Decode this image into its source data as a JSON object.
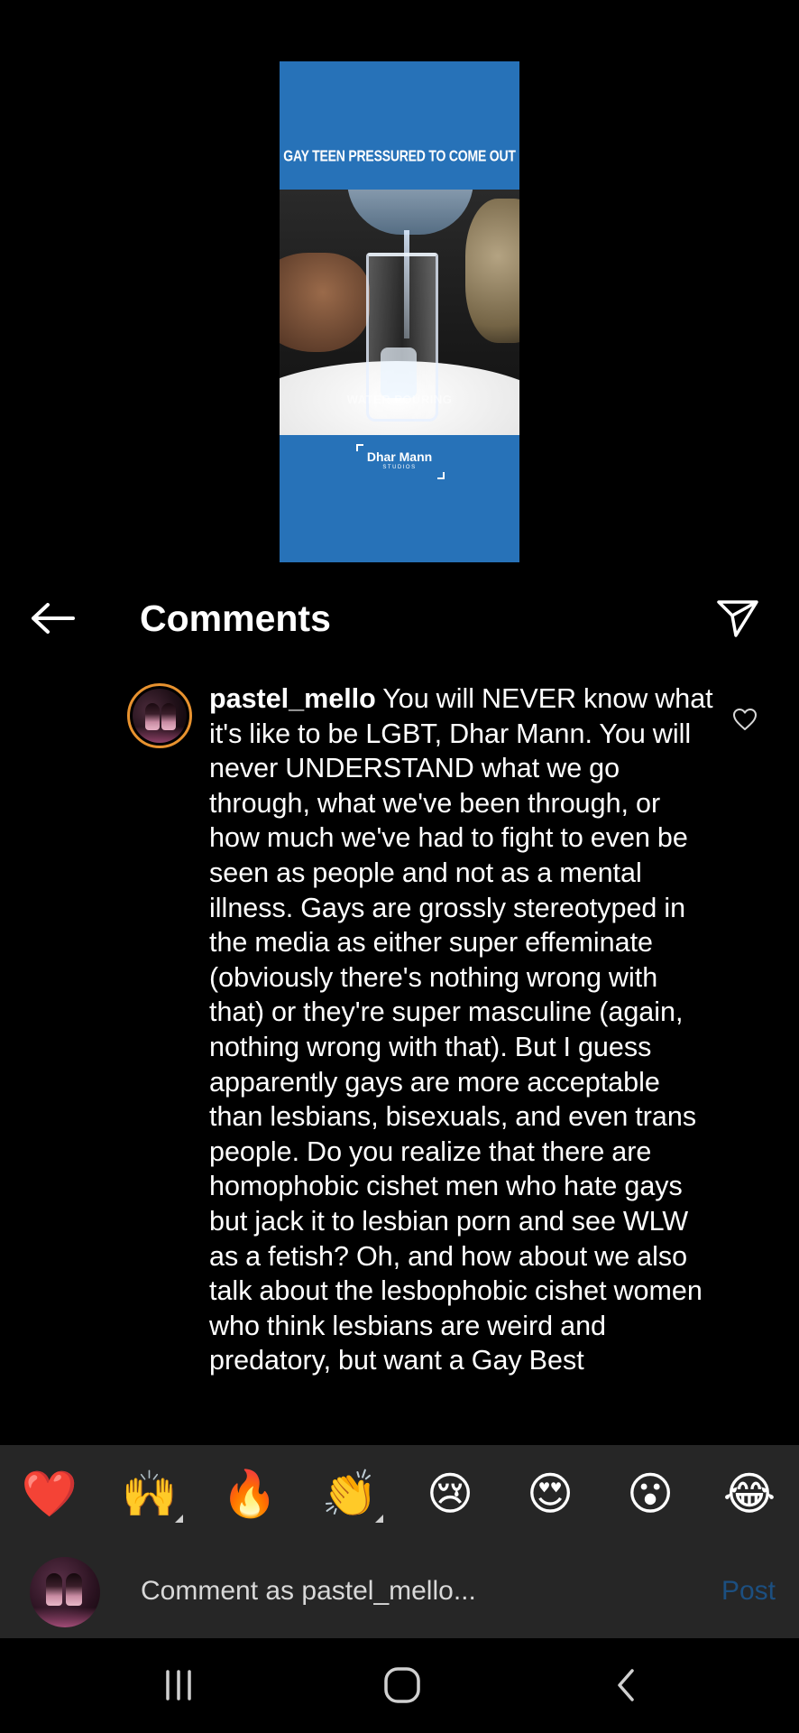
{
  "video": {
    "title": "GAY TEEN PRESSURED TO COME OUT",
    "caption": "WATER POURING",
    "logo_main": "Dhar Mann",
    "logo_sub": "STUDIOS"
  },
  "header": {
    "title": "Comments",
    "back_icon": "arrow-left-icon",
    "share_icon": "paper-plane-icon"
  },
  "comment": {
    "username": "pastel_mello",
    "text": "You will NEVER know what it's like to be LGBT, Dhar Mann. You will never UNDERSTAND what we go through, what we've been through, or how much we've had to fight to even be seen as people and not as a mental illness. Gays are grossly stereotyped in the media as either super effeminate (obviously there's nothing wrong with that) or they're super masculine (again, nothing wrong with that). But I guess apparently gays are more acceptable than lesbians, bisexuals, and even trans people. Do you realize that there are homophobic cishet men who hate gays but jack it to lesbian porn and see WLW as a fetish? Oh, and how about we also talk about the lesbophobic cishet women who think lesbians are weird and predatory, but want a Gay Best",
    "like_icon": "heart-outline-icon"
  },
  "emoji_bar": {
    "items": [
      {
        "emoji": "❤️",
        "name": "red-heart",
        "has_more": false
      },
      {
        "emoji": "🙌",
        "name": "raising-hands",
        "has_more": true
      },
      {
        "emoji": "🔥",
        "name": "fire",
        "has_more": false
      },
      {
        "emoji": "👏",
        "name": "clapping-hands",
        "has_more": true
      },
      {
        "emoji": "😢",
        "name": "crying-face",
        "has_more": false
      },
      {
        "emoji": "😍",
        "name": "heart-eyes-face",
        "has_more": false
      },
      {
        "emoji": "😮",
        "name": "surprised-face",
        "has_more": false
      },
      {
        "emoji": "😂",
        "name": "tears-of-joy-face",
        "has_more": false
      }
    ]
  },
  "input_bar": {
    "placeholder": "Comment as pastel_mello...",
    "value": "",
    "post_label": "Post"
  },
  "colors": {
    "background": "#000000",
    "panel": "#262626",
    "video_blue": "#2772b8",
    "post_disabled": "#1c4f80",
    "avatar_ring": "#e8922f"
  },
  "nav_bar": {
    "recents_icon": "recents-icon",
    "home_icon": "home-icon",
    "back_icon": "back-chevron-icon"
  }
}
